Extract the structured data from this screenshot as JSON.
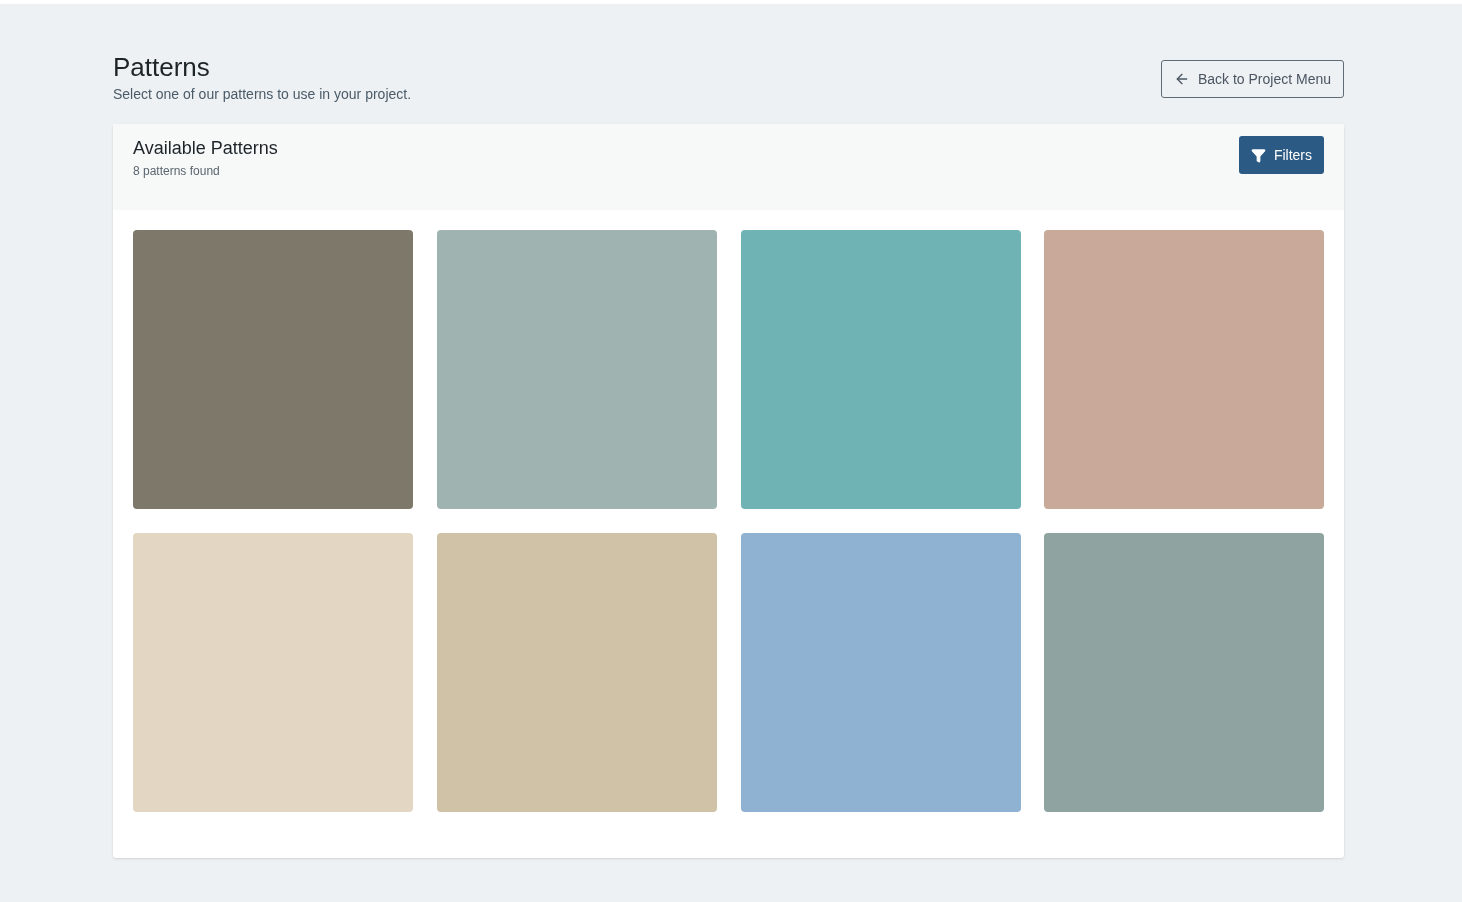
{
  "header": {
    "title": "Patterns",
    "subtitle": "Select one of our patterns to use in your project.",
    "back_button": "Back to Project Menu"
  },
  "panel": {
    "title": "Available Patterns",
    "count": "8 patterns found",
    "filters_button": "Filters"
  },
  "patterns": [
    {
      "color": "#7d7869"
    },
    {
      "color": "#9fb3b1"
    },
    {
      "color": "#6fb3b5"
    },
    {
      "color": "#c9a99a"
    },
    {
      "color": "#e3d7c3"
    },
    {
      "color": "#cfc2a6"
    },
    {
      "color": "#8fb2d3"
    },
    {
      "color": "#8fa3a0"
    }
  ]
}
